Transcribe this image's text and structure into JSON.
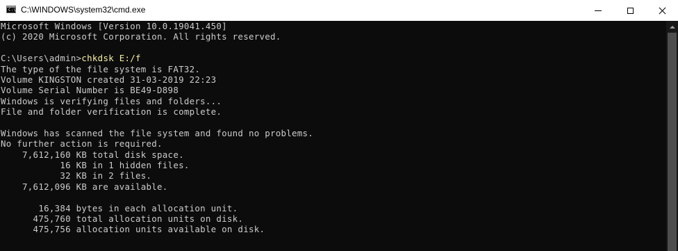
{
  "window": {
    "icon_text": "C:\\",
    "title": "C:\\WINDOWS\\system32\\cmd.exe"
  },
  "console": {
    "header": [
      "Microsoft Windows [Version 10.0.19041.450]",
      "(c) 2020 Microsoft Corporation. All rights reserved."
    ],
    "prompt": "C:\\Users\\admin>",
    "command": "chkdsk E:/f",
    "output": [
      "The type of the file system is FAT32.",
      "Volume KINGSTON created 31-03-2019 22:23",
      "Volume Serial Number is BE49-D898",
      "Windows is verifying files and folders...",
      "File and folder verification is complete.",
      "",
      "Windows has scanned the file system and found no problems.",
      "No further action is required.",
      "    7,612,160 KB total disk space.",
      "           16 KB in 1 hidden files.",
      "           32 KB in 2 files.",
      "    7,612,096 KB are available.",
      "",
      "       16,384 bytes in each allocation unit.",
      "      475,760 total allocation units on disk.",
      "      475,756 allocation units available on disk."
    ]
  },
  "colors": {
    "background": "#0c0c0c",
    "text": "#cccccc",
    "command": "#f9f1a5"
  }
}
